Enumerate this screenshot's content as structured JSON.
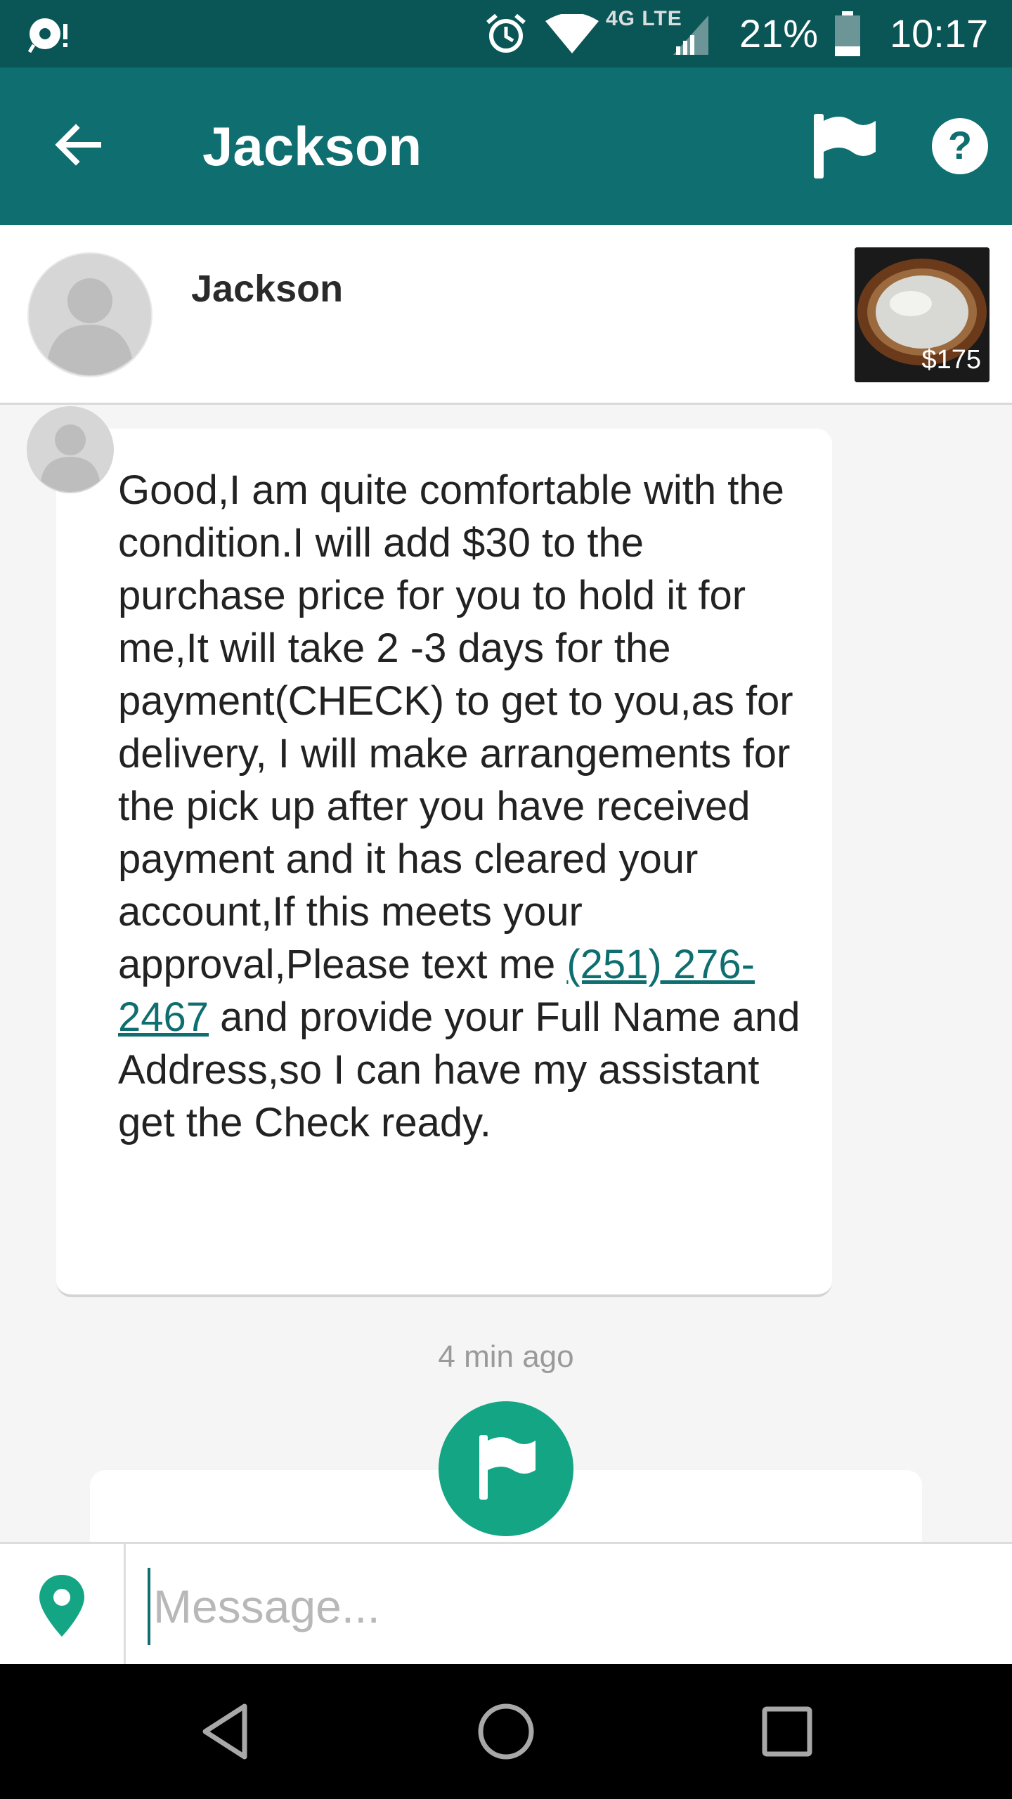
{
  "status_bar": {
    "network_label": "4G LTE",
    "battery_percent": "21%",
    "time": "10:17",
    "icons": [
      "notification-icon",
      "alarm-icon",
      "wifi-icon",
      "signal-icon",
      "battery-icon"
    ]
  },
  "app_bar": {
    "title": "Jackson",
    "back_icon": "arrow-left-icon",
    "flag_icon": "flag-icon",
    "help_icon": "help-circle-icon",
    "color": "#0e6e70"
  },
  "header": {
    "name": "Jackson",
    "item_price": "$175"
  },
  "conversation": {
    "message": {
      "text_before_phone": "Good,I am quite comfortable with the condition.I will add $30 to the purchase price for you to hold it for me,It will take 2 -3 days for the payment(CHECK) to get to you,as for delivery, I will make arrangements for the pick up after you have received payment and it has cleared your account,If this meets your approval,Please text me ",
      "phone": "(251) 276-2467",
      "text_after_phone": " and provide your Full Name and Address,so I can have my assistant get the Check ready."
    },
    "timestamp": "4 min ago",
    "flag_button_color": "#14a684"
  },
  "compose": {
    "placeholder": "Message...",
    "value": "",
    "location_icon": "location-pin-icon",
    "accent": "#14a684"
  },
  "nav_bar": {
    "buttons": [
      "back-triangle-icon",
      "home-circle-icon",
      "recents-square-icon"
    ]
  }
}
